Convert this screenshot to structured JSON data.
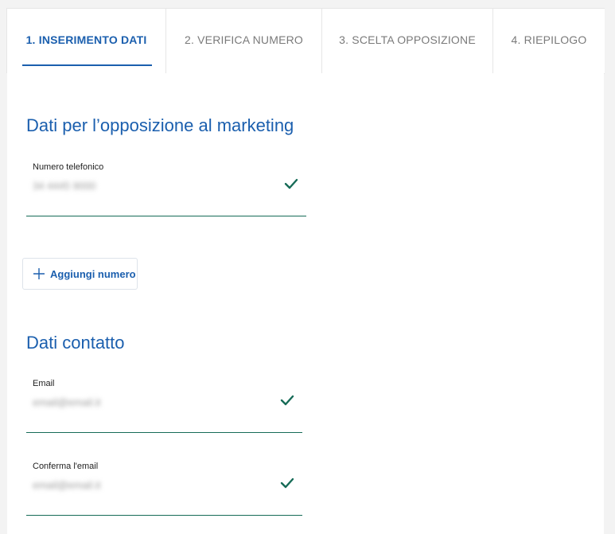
{
  "steps": [
    {
      "label": "1. INSERIMENTO DATI",
      "active": true
    },
    {
      "label": "2. VERIFICA NUMERO",
      "active": false
    },
    {
      "label": "3. SCELTA OPPOSIZIONE",
      "active": false
    },
    {
      "label": "4. RIEPILOGO",
      "active": false
    }
  ],
  "marketing": {
    "title": "Dati per l’opposizione al marketing",
    "phone": {
      "label": "Numero telefonico",
      "value": "34 4445 9000",
      "valid": true
    },
    "add_button_label": "Aggiungi numero"
  },
  "contact": {
    "title": "Dati contatto",
    "email": {
      "label": "Email",
      "value": "email@email.it",
      "valid": true
    },
    "confirm_email": {
      "label": "Conferma l'email",
      "value": "email@email.it",
      "valid": true
    }
  },
  "icons": {
    "check": "check-icon",
    "add": "plus-icon"
  },
  "colors": {
    "accent": "#1b5fae",
    "valid": "#166b57"
  }
}
